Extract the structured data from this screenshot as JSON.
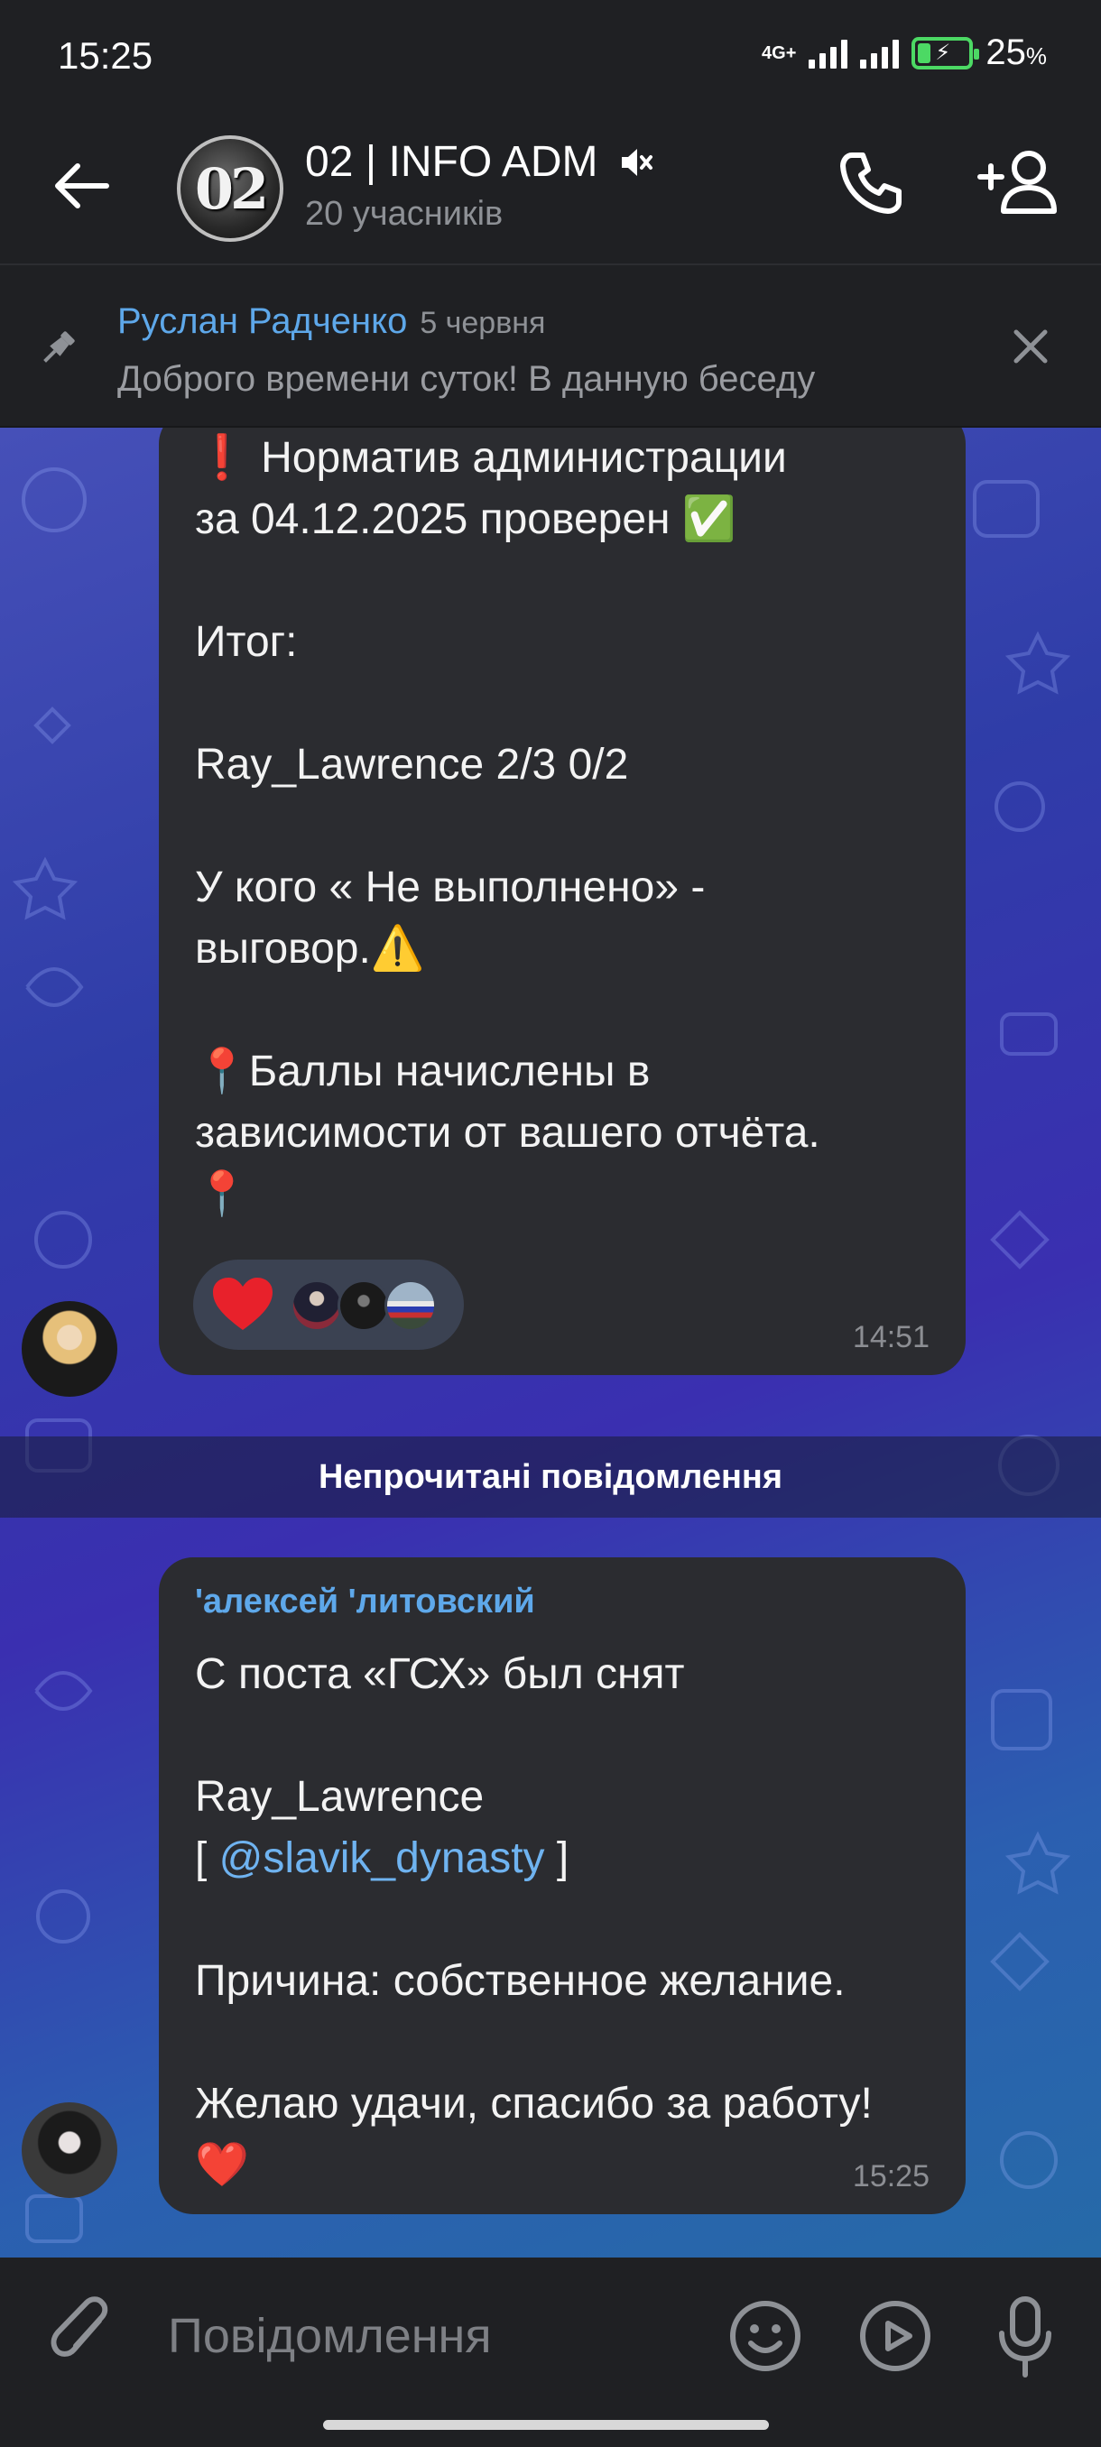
{
  "status_bar": {
    "time": "15:25",
    "network": "4G+",
    "battery_percent": "25",
    "battery_symbol": "%",
    "battery_level": 0.25
  },
  "header": {
    "avatar_text": "02",
    "title": "02 | INFO ADM",
    "subtitle": "20 учасників",
    "muted": true,
    "icons": [
      "back-arrow-icon",
      "muted-speaker-icon",
      "phone-icon",
      "add-person-icon"
    ]
  },
  "pinned": {
    "author": "Руслан Радченко",
    "date": "5 червня",
    "text": "Доброго времени суток!   В данную беседу"
  },
  "messages": [
    {
      "text": "❗  Норматив администрации\nза 04.12.2025 проверен ✅\n\nИтог:\n\nRay_Lawrence 2/3 0/2\n\nУ кого « Не выполнено» -\nвыговор.⚠️\n\n📍Баллы начислены в\nзависимости от вашего отчёта.\n📍",
      "time": "14:51",
      "reaction": "❤️"
    },
    {
      "sender": "'алексей 'литовский",
      "line1": "С поста «ГСХ» был снят",
      "line2": "Ray_Lawrence",
      "mention_open": "[ ",
      "mention": "@slavik_dynasty",
      "mention_close": " ]",
      "line3": "Причина: собственное желание.",
      "line4": "Желаю удачи, спасибо за работу!",
      "line5": "❤️",
      "time": "15:25"
    }
  ],
  "unread_divider": "Непрочитані повідомлення",
  "input": {
    "placeholder": "Повідомлення"
  },
  "colors": {
    "accent": "#5ea8ea",
    "bubble": "#2b2c30",
    "bar": "#1f2023",
    "battery": "#4cd964"
  }
}
